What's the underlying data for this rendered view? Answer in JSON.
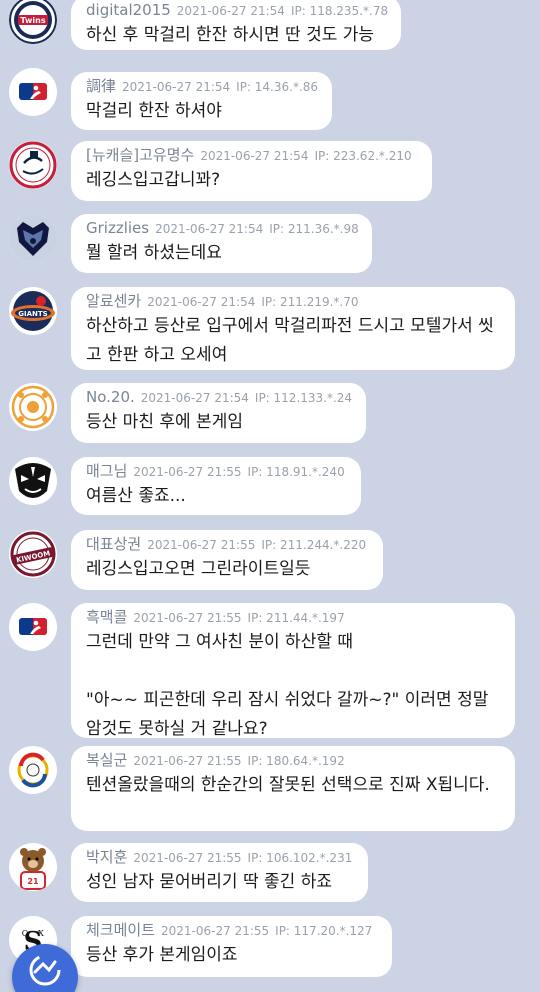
{
  "comments": [
    {
      "nickname": "digital2015",
      "datetime": "2021-06-27 21:54",
      "ip": "IP: 118.235.*.78",
      "text": "하신 후 막걸리 한잔 하시면 딴 것도 가능",
      "avatar_icon": "twins-logo-icon"
    },
    {
      "nickname": "調律",
      "datetime": "2021-06-27 21:54",
      "ip": "IP: 14.36.*.86",
      "text": "막걸리 한잔 하셔야",
      "avatar_icon": "mlb-logo-icon"
    },
    {
      "nickname": "[뉴캐슬]고유명수",
      "datetime": "2021-06-27 21:54",
      "ip": "IP: 223.62.*.210",
      "text": "레깅스입고갑니꽈?",
      "avatar_icon": "yankees-logo-icon"
    },
    {
      "nickname": "Grizzlies",
      "datetime": "2021-06-27 21:54",
      "ip": "IP: 211.36.*.98",
      "text": "뭘 할려 하셨는데요",
      "avatar_icon": "grizzlies-logo-icon"
    },
    {
      "nickname": "알료센카",
      "datetime": "2021-06-27 21:54",
      "ip": "IP: 211.219.*.70",
      "text": "하산하고 등산로 입구에서 막걸리파전 드시고 모텔가서 씻고 한판 하고 오세여",
      "avatar_icon": "giants-logo-icon"
    },
    {
      "nickname": "No.20.",
      "datetime": "2021-06-27 21:54",
      "ip": "IP: 112.133.*.24",
      "text": "등산 마친 후에 본게임",
      "avatar_icon": "circle-pattern-icon"
    },
    {
      "nickname": "매그님",
      "datetime": "2021-06-27 21:55",
      "ip": "IP: 118.91.*.240",
      "text": "여름산 좋죠...",
      "avatar_icon": "mask-icon"
    },
    {
      "nickname": "대표상권",
      "datetime": "2021-06-27 21:55",
      "ip": "IP: 211.244.*.220",
      "text": "레깅스입고오면 그린라이트일듯",
      "avatar_icon": "kiwoom-logo-icon"
    },
    {
      "nickname": "흑맥콜",
      "datetime": "2021-06-27 21:55",
      "ip": "IP: 211.44.*.197",
      "text": "그런데 만약 그 여사친 분이 하산할 때\n\n\"아~~ 피곤한데 우리 잠시 쉬었다 갈까~?\" 이러면 정말 암것도 못하실 거 같나요?",
      "avatar_icon": "mlb-logo-icon"
    },
    {
      "nickname": "복실군",
      "datetime": "2021-06-27 21:55",
      "ip": "IP: 180.64.*.192",
      "text": "텐션올랐을때의 한순간의 잘못된 선택으로 진짜 X됩니다.",
      "avatar_icon": "kbo-logo-icon"
    },
    {
      "nickname": "박지훈",
      "datetime": "2021-06-27 21:55",
      "ip": "IP: 106.102.*.231",
      "text": "성인 남자 묻어버리기 딱 좋긴 하죠",
      "avatar_icon": "bear-mascot-icon"
    },
    {
      "nickname": "체크메이트",
      "datetime": "2021-06-27 21:55",
      "ip": "IP: 117.20.*.127",
      "text": "등산 후가 본게임이죠",
      "avatar_icon": "white-sox-logo-icon"
    }
  ],
  "fab": {
    "icon": "refresh-icon"
  }
}
